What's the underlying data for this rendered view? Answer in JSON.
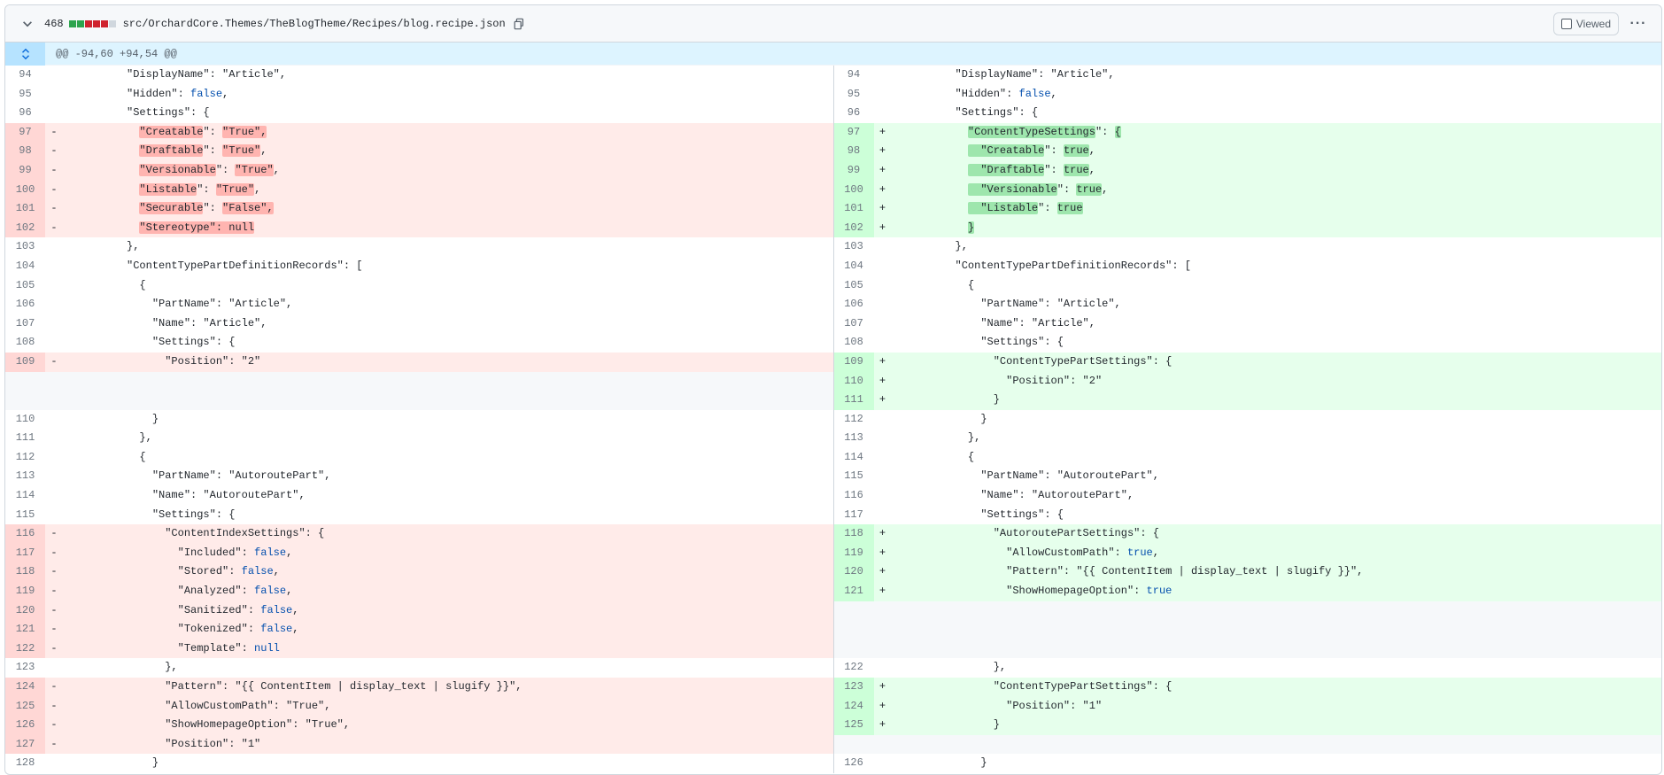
{
  "file": {
    "change_count": "468",
    "path": "src/OrchardCore.Themes/TheBlogTheme/Recipes/blog.recipe.json",
    "viewed_label": "Viewed",
    "stats_colors": [
      "#2da44e",
      "#2da44e",
      "#cf222e",
      "#cf222e",
      "#cf222e",
      "#d0d7de"
    ]
  },
  "hunk": {
    "header": "@@ -94,60 +94,54 @@"
  },
  "left": [
    {
      "type": "ctx",
      "n": "94",
      "m": "",
      "segs": [
        {
          "t": "          \"DisplayName\": \"Article\","
        }
      ]
    },
    {
      "type": "ctx",
      "n": "95",
      "m": "",
      "segs": [
        {
          "t": "          \"Hidden\": "
        },
        {
          "t": "false",
          "c": "kw"
        },
        {
          "t": ","
        }
      ]
    },
    {
      "type": "ctx",
      "n": "96",
      "m": "",
      "segs": [
        {
          "t": "          \"Settings\": {"
        }
      ]
    },
    {
      "type": "del",
      "n": "97",
      "m": "-",
      "segs": [
        {
          "t": "            "
        },
        {
          "t": "\"Creatable",
          "c": "hl-d"
        },
        {
          "t": "\": "
        },
        {
          "t": "\"True\",",
          "c": "hl-d"
        }
      ]
    },
    {
      "type": "del",
      "n": "98",
      "m": "-",
      "segs": [
        {
          "t": "            "
        },
        {
          "t": "\"Draftable",
          "c": "hl-d"
        },
        {
          "t": "\": "
        },
        {
          "t": "\"True\"",
          "c": "hl-d"
        },
        {
          "t": ","
        }
      ]
    },
    {
      "type": "del",
      "n": "99",
      "m": "-",
      "segs": [
        {
          "t": "            "
        },
        {
          "t": "\"Versionable",
          "c": "hl-d"
        },
        {
          "t": "\": "
        },
        {
          "t": "\"True\"",
          "c": "hl-d"
        },
        {
          "t": ","
        }
      ]
    },
    {
      "type": "del",
      "n": "100",
      "m": "-",
      "segs": [
        {
          "t": "            "
        },
        {
          "t": "\"Listable",
          "c": "hl-d"
        },
        {
          "t": "\": "
        },
        {
          "t": "\"True\"",
          "c": "hl-d"
        },
        {
          "t": ","
        }
      ]
    },
    {
      "type": "del",
      "n": "101",
      "m": "-",
      "segs": [
        {
          "t": "            "
        },
        {
          "t": "\"Securable",
          "c": "hl-d"
        },
        {
          "t": "\": "
        },
        {
          "t": "\"False\",",
          "c": "hl-d"
        }
      ]
    },
    {
      "type": "del",
      "n": "102",
      "m": "-",
      "segs": [
        {
          "t": "            "
        },
        {
          "t": "\"Stereotype\": null",
          "c": "hl-d"
        }
      ]
    },
    {
      "type": "ctx",
      "n": "103",
      "m": "",
      "segs": [
        {
          "t": "          },"
        }
      ]
    },
    {
      "type": "ctx",
      "n": "104",
      "m": "",
      "segs": [
        {
          "t": "          \"ContentTypePartDefinitionRecords\": ["
        }
      ]
    },
    {
      "type": "ctx",
      "n": "105",
      "m": "",
      "segs": [
        {
          "t": "            {"
        }
      ]
    },
    {
      "type": "ctx",
      "n": "106",
      "m": "",
      "segs": [
        {
          "t": "              \"PartName\": \"Article\","
        }
      ]
    },
    {
      "type": "ctx",
      "n": "107",
      "m": "",
      "segs": [
        {
          "t": "              \"Name\": \"Article\","
        }
      ]
    },
    {
      "type": "ctx",
      "n": "108",
      "m": "",
      "segs": [
        {
          "t": "              \"Settings\": {"
        }
      ]
    },
    {
      "type": "del",
      "n": "109",
      "m": "-",
      "segs": [
        {
          "t": "                \"Position\": \"2\""
        }
      ]
    },
    {
      "type": "empty",
      "n": "",
      "m": "",
      "segs": []
    },
    {
      "type": "empty",
      "n": "",
      "m": "",
      "segs": []
    },
    {
      "type": "ctx",
      "n": "110",
      "m": "",
      "segs": [
        {
          "t": "              }"
        }
      ]
    },
    {
      "type": "ctx",
      "n": "111",
      "m": "",
      "segs": [
        {
          "t": "            },"
        }
      ]
    },
    {
      "type": "ctx",
      "n": "112",
      "m": "",
      "segs": [
        {
          "t": "            {"
        }
      ]
    },
    {
      "type": "ctx",
      "n": "113",
      "m": "",
      "segs": [
        {
          "t": "              \"PartName\": \"AutoroutePart\","
        }
      ]
    },
    {
      "type": "ctx",
      "n": "114",
      "m": "",
      "segs": [
        {
          "t": "              \"Name\": \"AutoroutePart\","
        }
      ]
    },
    {
      "type": "ctx",
      "n": "115",
      "m": "",
      "segs": [
        {
          "t": "              \"Settings\": {"
        }
      ]
    },
    {
      "type": "del",
      "n": "116",
      "m": "-",
      "segs": [
        {
          "t": "                \"ContentIndexSettings\": {"
        }
      ]
    },
    {
      "type": "del",
      "n": "117",
      "m": "-",
      "segs": [
        {
          "t": "                  \"Included\": "
        },
        {
          "t": "false",
          "c": "kw"
        },
        {
          "t": ","
        }
      ]
    },
    {
      "type": "del",
      "n": "118",
      "m": "-",
      "segs": [
        {
          "t": "                  \"Stored\": "
        },
        {
          "t": "false",
          "c": "kw"
        },
        {
          "t": ","
        }
      ]
    },
    {
      "type": "del",
      "n": "119",
      "m": "-",
      "segs": [
        {
          "t": "                  \"Analyzed\": "
        },
        {
          "t": "false",
          "c": "kw"
        },
        {
          "t": ","
        }
      ]
    },
    {
      "type": "del",
      "n": "120",
      "m": "-",
      "segs": [
        {
          "t": "                  \"Sanitized\": "
        },
        {
          "t": "false",
          "c": "kw"
        },
        {
          "t": ","
        }
      ]
    },
    {
      "type": "del",
      "n": "121",
      "m": "-",
      "segs": [
        {
          "t": "                  \"Tokenized\": "
        },
        {
          "t": "false",
          "c": "kw"
        },
        {
          "t": ","
        }
      ]
    },
    {
      "type": "del",
      "n": "122",
      "m": "-",
      "segs": [
        {
          "t": "                  \"Template\": "
        },
        {
          "t": "null",
          "c": "kw"
        }
      ]
    },
    {
      "type": "ctx",
      "n": "123",
      "m": "",
      "segs": [
        {
          "t": "                },"
        }
      ]
    },
    {
      "type": "del",
      "n": "124",
      "m": "-",
      "segs": [
        {
          "t": "                \"Pattern\": \"{{ ContentItem | display_text | slugify }}\","
        }
      ]
    },
    {
      "type": "del",
      "n": "125",
      "m": "-",
      "segs": [
        {
          "t": "                \"AllowCustomPath\": \"True\","
        }
      ]
    },
    {
      "type": "del",
      "n": "126",
      "m": "-",
      "segs": [
        {
          "t": "                \"ShowHomepageOption\": \"True\","
        }
      ]
    },
    {
      "type": "del",
      "n": "127",
      "m": "-",
      "segs": [
        {
          "t": "                \"Position\": \"1\""
        }
      ]
    },
    {
      "type": "ctx",
      "n": "128",
      "m": "",
      "segs": [
        {
          "t": "              }"
        }
      ]
    }
  ],
  "right": [
    {
      "type": "ctx",
      "n": "94",
      "m": "",
      "segs": [
        {
          "t": "          \"DisplayName\": \"Article\","
        }
      ]
    },
    {
      "type": "ctx",
      "n": "95",
      "m": "",
      "segs": [
        {
          "t": "          \"Hidden\": "
        },
        {
          "t": "false",
          "c": "kw"
        },
        {
          "t": ","
        }
      ]
    },
    {
      "type": "ctx",
      "n": "96",
      "m": "",
      "segs": [
        {
          "t": "          \"Settings\": {"
        }
      ]
    },
    {
      "type": "add",
      "n": "97",
      "m": "+",
      "segs": [
        {
          "t": "            "
        },
        {
          "t": "\"ContentTypeSettings",
          "c": "hl-a"
        },
        {
          "t": "\": "
        },
        {
          "t": "{",
          "c": "hl-a"
        }
      ]
    },
    {
      "type": "add",
      "n": "98",
      "m": "+",
      "segs": [
        {
          "t": "            "
        },
        {
          "t": "  \"Creatable",
          "c": "hl-a"
        },
        {
          "t": "\": "
        },
        {
          "t": "true",
          "c": "hl-a"
        },
        {
          "t": ","
        }
      ]
    },
    {
      "type": "add",
      "n": "99",
      "m": "+",
      "segs": [
        {
          "t": "            "
        },
        {
          "t": "  \"Draftable",
          "c": "hl-a"
        },
        {
          "t": "\": "
        },
        {
          "t": "true",
          "c": "hl-a"
        },
        {
          "t": ","
        }
      ]
    },
    {
      "type": "add",
      "n": "100",
      "m": "+",
      "segs": [
        {
          "t": "            "
        },
        {
          "t": "  \"Versionable",
          "c": "hl-a"
        },
        {
          "t": "\": "
        },
        {
          "t": "true",
          "c": "hl-a"
        },
        {
          "t": ","
        }
      ]
    },
    {
      "type": "add",
      "n": "101",
      "m": "+",
      "segs": [
        {
          "t": "            "
        },
        {
          "t": "  \"Listable",
          "c": "hl-a"
        },
        {
          "t": "\": "
        },
        {
          "t": "true",
          "c": "hl-a"
        }
      ]
    },
    {
      "type": "add",
      "n": "102",
      "m": "+",
      "segs": [
        {
          "t": "            "
        },
        {
          "t": "}",
          "c": "hl-a"
        }
      ]
    },
    {
      "type": "ctx",
      "n": "103",
      "m": "",
      "segs": [
        {
          "t": "          },"
        }
      ]
    },
    {
      "type": "ctx",
      "n": "104",
      "m": "",
      "segs": [
        {
          "t": "          \"ContentTypePartDefinitionRecords\": ["
        }
      ]
    },
    {
      "type": "ctx",
      "n": "105",
      "m": "",
      "segs": [
        {
          "t": "            {"
        }
      ]
    },
    {
      "type": "ctx",
      "n": "106",
      "m": "",
      "segs": [
        {
          "t": "              \"PartName\": \"Article\","
        }
      ]
    },
    {
      "type": "ctx",
      "n": "107",
      "m": "",
      "segs": [
        {
          "t": "              \"Name\": \"Article\","
        }
      ]
    },
    {
      "type": "ctx",
      "n": "108",
      "m": "",
      "segs": [
        {
          "t": "              \"Settings\": {"
        }
      ]
    },
    {
      "type": "add",
      "n": "109",
      "m": "+",
      "segs": [
        {
          "t": "                \"ContentTypePartSettings\": {"
        }
      ]
    },
    {
      "type": "add",
      "n": "110",
      "m": "+",
      "segs": [
        {
          "t": "                  \"Position\": \"2\""
        }
      ]
    },
    {
      "type": "add",
      "n": "111",
      "m": "+",
      "segs": [
        {
          "t": "                }"
        }
      ]
    },
    {
      "type": "ctx",
      "n": "112",
      "m": "",
      "segs": [
        {
          "t": "              }"
        }
      ]
    },
    {
      "type": "ctx",
      "n": "113",
      "m": "",
      "segs": [
        {
          "t": "            },"
        }
      ]
    },
    {
      "type": "ctx",
      "n": "114",
      "m": "",
      "segs": [
        {
          "t": "            {"
        }
      ]
    },
    {
      "type": "ctx",
      "n": "115",
      "m": "",
      "segs": [
        {
          "t": "              \"PartName\": \"AutoroutePart\","
        }
      ]
    },
    {
      "type": "ctx",
      "n": "116",
      "m": "",
      "segs": [
        {
          "t": "              \"Name\": \"AutoroutePart\","
        }
      ]
    },
    {
      "type": "ctx",
      "n": "117",
      "m": "",
      "segs": [
        {
          "t": "              \"Settings\": {"
        }
      ]
    },
    {
      "type": "add",
      "n": "118",
      "m": "+",
      "segs": [
        {
          "t": "                \"AutoroutePartSettings\": {"
        }
      ]
    },
    {
      "type": "add",
      "n": "119",
      "m": "+",
      "segs": [
        {
          "t": "                  \"AllowCustomPath\": "
        },
        {
          "t": "true",
          "c": "kw"
        },
        {
          "t": ","
        }
      ]
    },
    {
      "type": "add",
      "n": "120",
      "m": "+",
      "segs": [
        {
          "t": "                  \"Pattern\": \"{{ ContentItem | display_text | slugify }}\","
        }
      ]
    },
    {
      "type": "add",
      "n": "121",
      "m": "+",
      "segs": [
        {
          "t": "                  \"ShowHomepageOption\": "
        },
        {
          "t": "true",
          "c": "kw"
        }
      ]
    },
    {
      "type": "empty",
      "n": "",
      "m": "",
      "segs": []
    },
    {
      "type": "empty",
      "n": "",
      "m": "",
      "segs": []
    },
    {
      "type": "empty",
      "n": "",
      "m": "",
      "segs": []
    },
    {
      "type": "ctx",
      "n": "122",
      "m": "",
      "segs": [
        {
          "t": "                },"
        }
      ]
    },
    {
      "type": "add",
      "n": "123",
      "m": "+",
      "segs": [
        {
          "t": "                \"ContentTypePartSettings\": {"
        }
      ]
    },
    {
      "type": "add",
      "n": "124",
      "m": "+",
      "segs": [
        {
          "t": "                  \"Position\": \"1\""
        }
      ]
    },
    {
      "type": "add",
      "n": "125",
      "m": "+",
      "segs": [
        {
          "t": "                }"
        }
      ]
    },
    {
      "type": "empty",
      "n": "",
      "m": "",
      "segs": []
    },
    {
      "type": "ctx",
      "n": "126",
      "m": "",
      "segs": [
        {
          "t": "              }"
        }
      ]
    }
  ]
}
